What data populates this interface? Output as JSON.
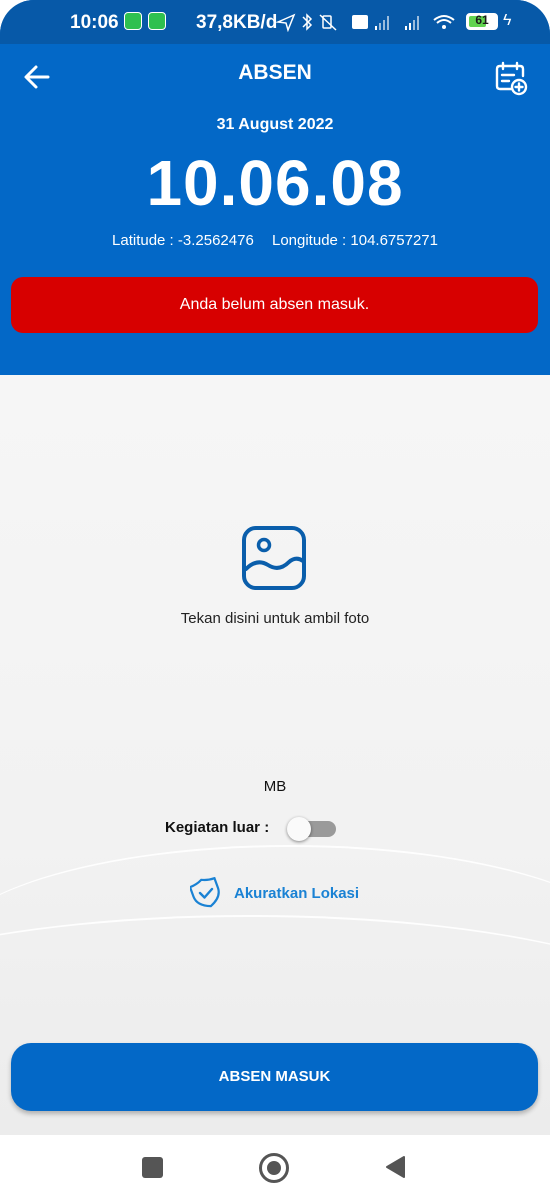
{
  "status_bar": {
    "time": "10:06",
    "speed": "37,8KB/d",
    "battery": "61",
    "notification_icons": [
      "whatsapp-icon",
      "android-icon"
    ],
    "system_icons": [
      "location-arrow-icon",
      "bluetooth-icon",
      "mute-vibrate-icon",
      "volte-icon",
      "signal-icon",
      "signal-icon",
      "wifi-icon",
      "battery-icon",
      "charging-icon"
    ]
  },
  "header": {
    "title": "ABSEN",
    "date": "31 August 2022",
    "clock": "10.06.08",
    "latitude": "Latitude : -3.2562476",
    "longitude": "Longitude : 104.6757271",
    "alert": "Anda belum absen masuk."
  },
  "photo": {
    "label": "Tekan disini untuk ambil foto"
  },
  "size_label": "MB",
  "kegiatan": {
    "label": "Kegiatan luar :",
    "enabled": false
  },
  "lokasi": {
    "label": "Akuratkan Lokasi"
  },
  "action_button": {
    "label": "ABSEN MASUK"
  },
  "colors": {
    "primary": "#0368c7",
    "status_bar": "#0759a8",
    "alert": "#d70000",
    "link": "#1a82d4"
  }
}
